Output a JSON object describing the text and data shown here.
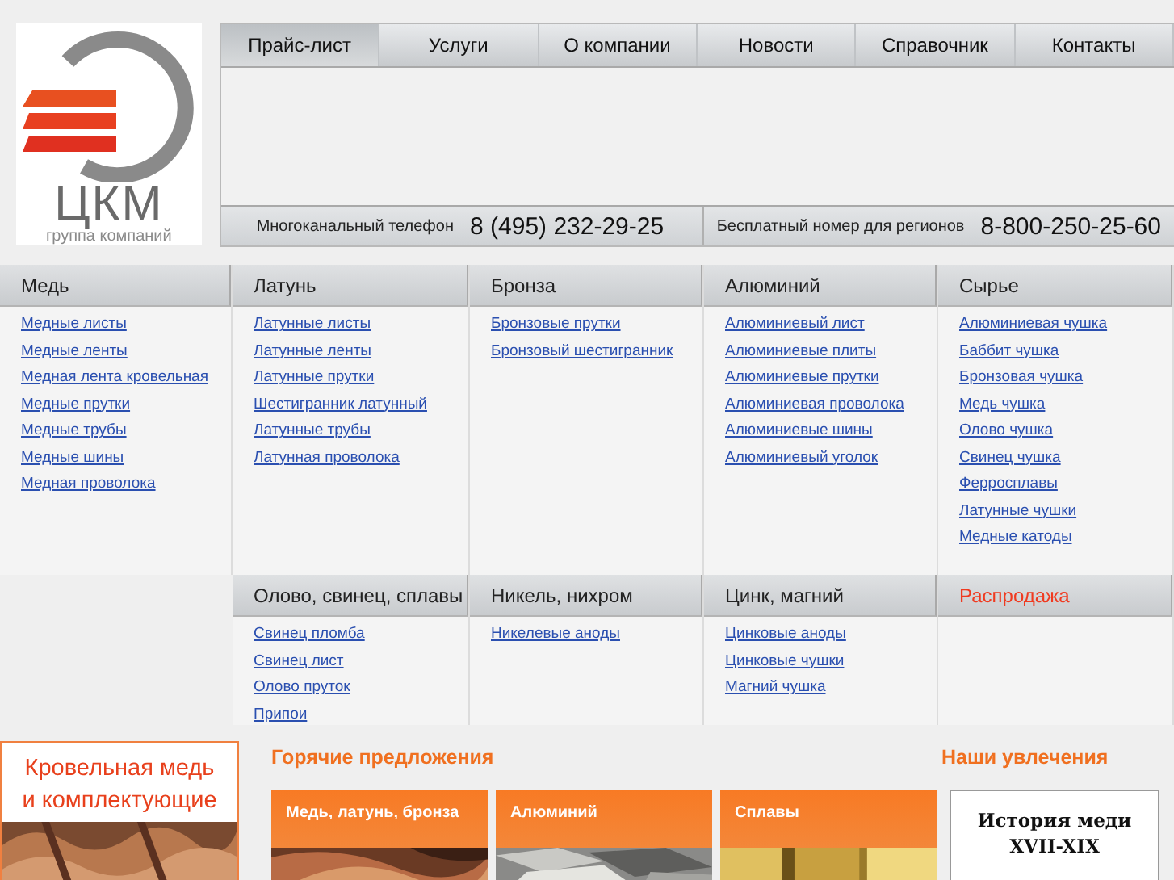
{
  "logo": {
    "name": "ЦКМ",
    "subtitle": "группа компаний"
  },
  "nav": [
    {
      "label": "Прайс-лист",
      "selected": true
    },
    {
      "label": "Услуги",
      "selected": false
    },
    {
      "label": "О компании",
      "selected": false
    },
    {
      "label": "Новости",
      "selected": false
    },
    {
      "label": "Справочник",
      "selected": false
    },
    {
      "label": "Контакты",
      "selected": false
    }
  ],
  "phones": [
    {
      "label": "Многоканальный телефон",
      "number": "8 (495) 232-29-25"
    },
    {
      "label": "Бесплатный номер для регионов",
      "number": "8-800-250-25-60"
    }
  ],
  "catalog_rows": [
    {
      "columns": [
        {
          "title": "Медь",
          "kind": "normal",
          "links": [
            "Медные листы",
            "Медные ленты",
            "Медная лента кровельная",
            "Медные прутки",
            "Медные трубы",
            "Медные шины",
            "Медная проволока"
          ]
        },
        {
          "title": "Латунь",
          "kind": "normal",
          "links": [
            "Латунные листы",
            "Латунные ленты",
            "Латунные прутки",
            "Шестигранник латунный",
            "Латунные трубы",
            "Латунная проволока"
          ]
        },
        {
          "title": "Бронза",
          "kind": "normal",
          "links": [
            "Бронзовые прутки",
            "Бронзовый шестигранник"
          ]
        },
        {
          "title": "Алюминий",
          "kind": "normal",
          "links": [
            "Алюминиевый лист",
            "Алюминиевые плиты",
            "Алюминиевые прутки",
            "Алюминиевая проволока",
            "Алюминиевые шины",
            "Алюминиевый уголок"
          ]
        },
        {
          "title": "Сырье",
          "kind": "normal",
          "links": [
            "Алюминиевая чушка",
            "Баббит чушка",
            "Бронзовая чушка",
            "Медь чушка",
            "Олово чушка",
            "Свинец чушка",
            "Ферросплавы",
            "Латунные чушки",
            "Медные катоды"
          ]
        }
      ]
    },
    {
      "columns": [
        {
          "title": "Олово, свинец, сплавы",
          "kind": "normal",
          "links": [
            "Свинец пломба",
            "Свинец лист",
            "Олово пруток",
            "Припои"
          ]
        },
        {
          "title": "Никель, нихром",
          "kind": "normal",
          "links": [
            "Никелевые аноды"
          ]
        },
        {
          "title": "Цинк, магний",
          "kind": "normal",
          "links": [
            "Цинковые аноды",
            "Цинковые чушки",
            "Магний чушка"
          ]
        },
        {
          "title": "Распродажа",
          "kind": "sale"
        }
      ]
    }
  ],
  "promo": {
    "lines": [
      "Кровельная медь",
      "и комплектующие"
    ]
  },
  "hot_offers": {
    "title": "Горячие предложения",
    "cards": [
      {
        "label": "Медь, латунь, бронза"
      },
      {
        "label": "Алюминий"
      },
      {
        "label": "Сплавы"
      }
    ]
  },
  "hobbies": {
    "title": "Наши увлечения",
    "card": {
      "lines": [
        "История меди",
        "XVII-XIX"
      ]
    }
  }
}
